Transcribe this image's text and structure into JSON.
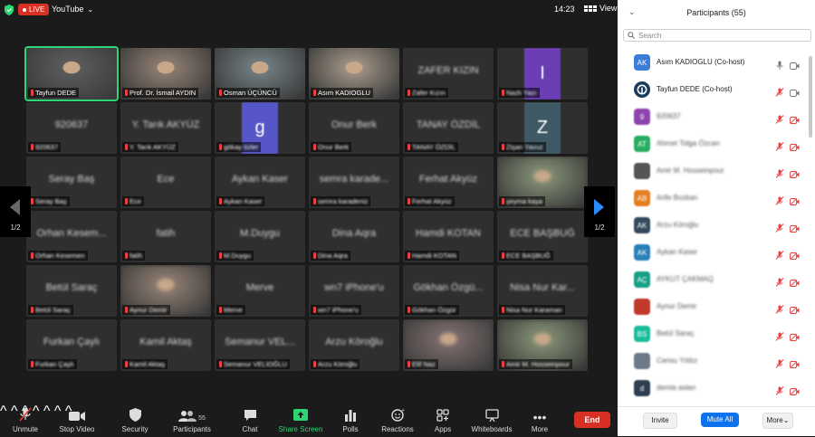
{
  "topbar": {
    "live_label": "LIVE",
    "stream_target": "YouTube",
    "clock": "14:23",
    "view_label": "View"
  },
  "tiles": [
    {
      "name": "Tayfun DEDE",
      "display": "",
      "photo": true,
      "active": true
    },
    {
      "name": "Prof. Dr. İsmail AYDIN",
      "display": "",
      "photo": true
    },
    {
      "name": "Osman ÜÇÜNCÜ",
      "display": "",
      "photo": true
    },
    {
      "name": "Asım KADIOGLU",
      "display": "",
      "photo": true
    },
    {
      "name": "Zafer Kızın",
      "display": "ZAFER KIZIN",
      "blur": true
    },
    {
      "name": "Nazlı Yazı",
      "display": "",
      "avatar": "I",
      "avatar_color": "#6b3fb3",
      "blur": true
    },
    {
      "name": "920637",
      "display": "920637",
      "blur": true
    },
    {
      "name": "Y. Tarık AKYÜZ",
      "display": "Y. Tarık AKYÜZ",
      "blur": true
    },
    {
      "name": "gökay özler",
      "display": "",
      "avatar": "g",
      "avatar_color": "#5656c8",
      "blur": true
    },
    {
      "name": "Onur Berk",
      "display": "Onur Berk",
      "blur": true
    },
    {
      "name": "TANAY ÖZDİL",
      "display": "TANAY ÖZDİL",
      "blur": true
    },
    {
      "name": "Zişan Yavuz",
      "display": "",
      "avatar": "Z",
      "avatar_color": "#3f5a66",
      "blur": true
    },
    {
      "name": "Seray Baş",
      "display": "Seray Baş",
      "blur": true
    },
    {
      "name": "Ece",
      "display": "Ece",
      "blur": true
    },
    {
      "name": "Aykan Kaser",
      "display": "Aykan Kaser",
      "blur": true
    },
    {
      "name": "semra karadeniz",
      "display": "semra karade...",
      "blur": true
    },
    {
      "name": "Ferhat Akyüz",
      "display": "Ferhat Akyüz",
      "blur": true
    },
    {
      "name": "şeyma kaya",
      "display": "",
      "photo": true,
      "blur": true
    },
    {
      "name": "Orhan Kesemen",
      "display": "Orhan Kesem...",
      "blur": true
    },
    {
      "name": "fatih",
      "display": "fatih",
      "blur": true
    },
    {
      "name": "M.Duygu",
      "display": "M.Duygu",
      "blur": true
    },
    {
      "name": "Dina Aqra",
      "display": "Dina Aqra",
      "blur": true
    },
    {
      "name": "Hamdi KOTAN",
      "display": "Hamdi KOTAN",
      "blur": true
    },
    {
      "name": "ECE BAŞBUĞ",
      "display": "ECE BAŞBUĞ",
      "blur": true
    },
    {
      "name": "Betül Saraç",
      "display": "Betül Saraç",
      "blur": true
    },
    {
      "name": "Aynur Demir",
      "display": "",
      "photo": true,
      "blur": true
    },
    {
      "name": "Merve",
      "display": "Merve",
      "blur": true
    },
    {
      "name": "wn7 iPhone'u",
      "display": "wn7 iPhone'u",
      "blur": true
    },
    {
      "name": "Gökhan Özgür",
      "display": "Gökhan Özgü...",
      "blur": true
    },
    {
      "name": "Nisa Nur Karaman",
      "display": "Nisa Nur Kar...",
      "blur": true
    },
    {
      "name": "Furkan Çaylı",
      "display": "Furkan Çaylı",
      "blur": true
    },
    {
      "name": "Kamil Aktaş",
      "display": "Kamil Aktaş",
      "blur": true
    },
    {
      "name": "Semanur VELİOĞLU",
      "display": "Semanur VEL...",
      "blur": true
    },
    {
      "name": "Arzu Köroğlu",
      "display": "Arzu Köroğlu",
      "blur": true
    },
    {
      "name": "Elif Naz",
      "display": "",
      "photo": true,
      "blur": true
    },
    {
      "name": "Amir M. Hosseinpour",
      "display": "",
      "photo": true,
      "blur": true
    }
  ],
  "pager": {
    "left": "1/2",
    "right": "1/2"
  },
  "toolbar": {
    "unmute": "Unmute",
    "stop_video": "Stop Video",
    "security": "Security",
    "participants": "Participants",
    "participants_count": "55",
    "chat": "Chat",
    "share_screen": "Share Screen",
    "polls": "Polls",
    "reactions": "Reactions",
    "apps": "Apps",
    "whiteboards": "Whiteboards",
    "more": "More",
    "end": "End"
  },
  "panel": {
    "title": "Participants (55)",
    "search_placeholder": "Search",
    "participants": [
      {
        "name": "Asım KADIOGLU (Co-host)",
        "avatar_text": "AK",
        "color": "#3b7dd8",
        "mic": "on",
        "cam": "on"
      },
      {
        "name": "Tayfun DEDE (Co-host)",
        "avatar_text": "",
        "color": "#1b3b5c",
        "mic": "off",
        "cam": "on"
      },
      {
        "name": "920637",
        "avatar_text": "9",
        "color": "#8e44ad",
        "blur": true
      },
      {
        "name": "Ahmet Tolga Özcan",
        "avatar_text": "AT",
        "color": "#27ae60",
        "blur": true
      },
      {
        "name": "Amir M. Hosseinpour",
        "avatar_text": "",
        "color": "#555555",
        "blur": true
      },
      {
        "name": "Arife Bozkan",
        "avatar_text": "AB",
        "color": "#e67e22",
        "blur": true
      },
      {
        "name": "Arzu Köroğlu",
        "avatar_text": "AK",
        "color": "#34495e",
        "blur": true
      },
      {
        "name": "Aykan Kaser",
        "avatar_text": "AK",
        "color": "#2980b9",
        "blur": true
      },
      {
        "name": "AYKUT ÇAKMAQ",
        "avatar_text": "AÇ",
        "color": "#16a085",
        "blur": true
      },
      {
        "name": "Aynur Demir",
        "avatar_text": "",
        "color": "#c0392b",
        "blur": true
      },
      {
        "name": "Betül Saraç",
        "avatar_text": "BS",
        "color": "#1abc9c",
        "blur": true
      },
      {
        "name": "Cansu Yıldız",
        "avatar_text": "",
        "color": "#6d7a8a",
        "blur": true
      },
      {
        "name": "demla aslan",
        "avatar_text": "d",
        "color": "#2c3e50",
        "blur": true
      }
    ],
    "invite": "Invite",
    "mute_all": "Mute All",
    "more": "More"
  },
  "colors": {
    "accent_blue": "#0e72ed",
    "end_red": "#d93025",
    "active_green": "#2ed573",
    "muted_red": "#e84040"
  }
}
